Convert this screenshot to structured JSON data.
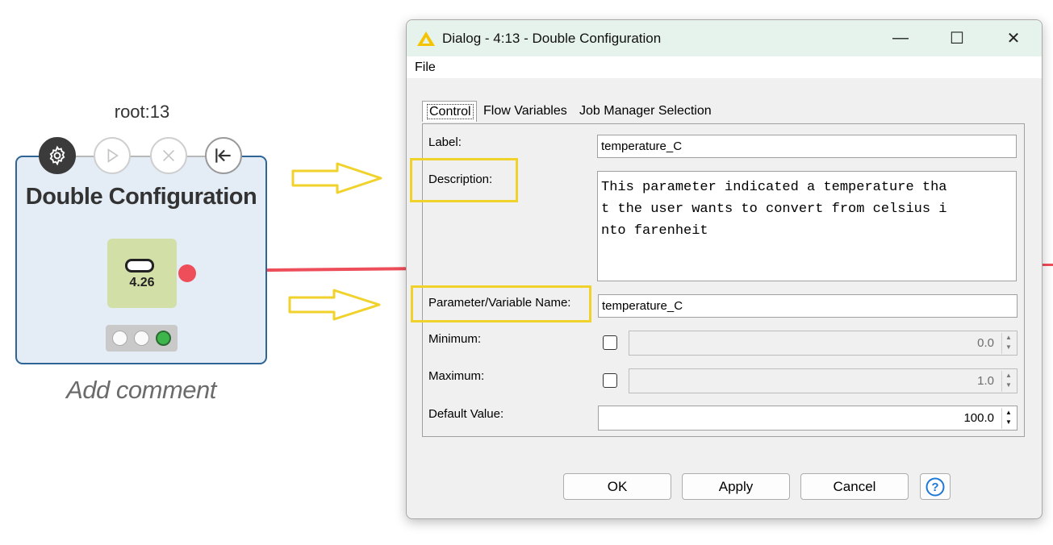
{
  "canvas": {
    "node_id": "root:13",
    "node_title": "Double Configuration",
    "node_icon_value": "4.26",
    "add_comment": "Add comment",
    "action_icons": [
      "gear-icon",
      "play-icon",
      "cancel-x-icon",
      "reset-arrow-icon"
    ],
    "connection_color": "#ee4d5a",
    "node_border_color": "#2f6496",
    "node_status": "executed (green)"
  },
  "annotations": {
    "highlight_color": "#f1d22b"
  },
  "dialog": {
    "title": "Dialog - 4:13 - Double Configuration",
    "window_buttons": {
      "minimize": "—",
      "maximize": "☐",
      "close": "✕"
    },
    "menu": {
      "file": "File"
    },
    "tabs": [
      {
        "label": "Control",
        "active": true
      },
      {
        "label": "Flow Variables",
        "active": false
      },
      {
        "label": "Job Manager Selection",
        "active": false
      }
    ],
    "form": {
      "label_label": "Label:",
      "label_value": "temperature_C",
      "description_label": "Description:",
      "description_lines": [
        "This parameter indicated a temperature tha",
        "t the user wants to convert from celsius i",
        "nto farenheit"
      ],
      "param_label": "Parameter/Variable Name:",
      "param_value": "temperature_C",
      "minimum_label": "Minimum:",
      "minimum_value": "0.0",
      "minimum_checked": false,
      "maximum_label": "Maximum:",
      "maximum_value": "1.0",
      "maximum_checked": false,
      "default_label": "Default Value:",
      "default_value": "100.0"
    },
    "buttons": {
      "ok": "OK",
      "apply": "Apply",
      "cancel": "Cancel",
      "help": "?"
    }
  }
}
